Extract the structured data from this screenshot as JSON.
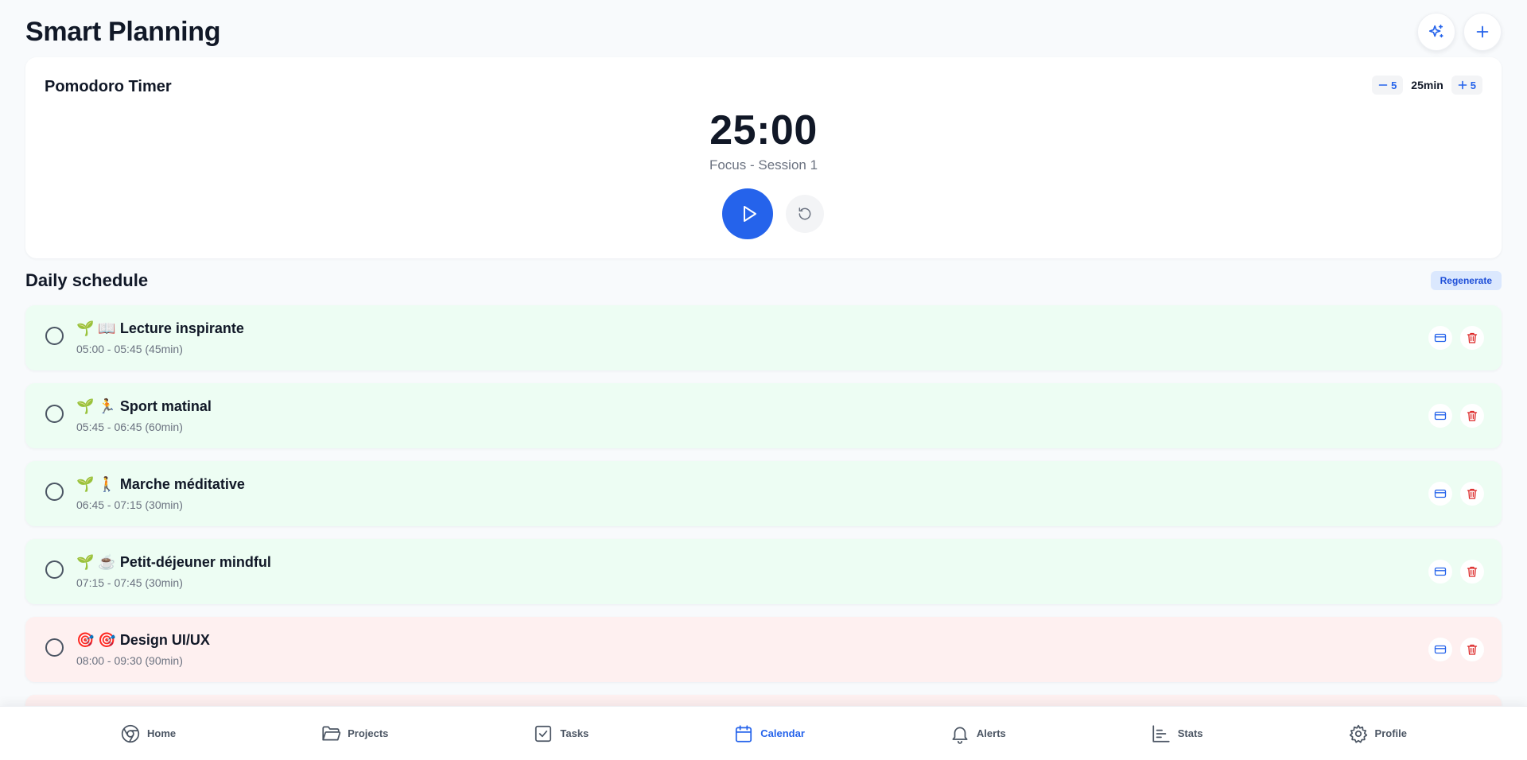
{
  "header": {
    "title": "Smart Planning",
    "ai_icon": "sparkles-icon",
    "add_icon": "plus-icon"
  },
  "pomodoro": {
    "title": "Pomodoro Timer",
    "decrease_label": "5",
    "duration_label": "25min",
    "increase_label": "5",
    "time": "25:00",
    "session": "Focus - Session 1"
  },
  "schedule": {
    "title": "Daily schedule",
    "regenerate_label": "Regenerate",
    "items": [
      {
        "title": "🌱 📖 Lecture inspirante",
        "time": "05:00 - 05:45 (45min)",
        "variant": "green"
      },
      {
        "title": "🌱 🏃 Sport matinal",
        "time": "05:45 - 06:45 (60min)",
        "variant": "green"
      },
      {
        "title": "🌱 🚶 Marche méditative",
        "time": "06:45 - 07:15 (30min)",
        "variant": "green"
      },
      {
        "title": "🌱 ☕ Petit-déjeuner mindful",
        "time": "07:15 - 07:45 (30min)",
        "variant": "green"
      },
      {
        "title": "🎯 🎯 Design UI/UX",
        "time": "08:00 - 09:30 (90min)",
        "variant": "red"
      },
      {
        "title": "",
        "time": "",
        "variant": "red"
      }
    ]
  },
  "nav": {
    "items": [
      {
        "label": "Home",
        "icon": "chrome-icon",
        "active": false
      },
      {
        "label": "Projects",
        "icon": "folder-icon",
        "active": false
      },
      {
        "label": "Tasks",
        "icon": "checkbox-icon",
        "active": false
      },
      {
        "label": "Calendar",
        "icon": "calendar-icon",
        "active": true
      },
      {
        "label": "Alerts",
        "icon": "bell-icon",
        "active": false
      },
      {
        "label": "Stats",
        "icon": "bar-chart-icon",
        "active": false
      },
      {
        "label": "Profile",
        "icon": "gear-icon",
        "active": false
      }
    ]
  },
  "colors": {
    "accent": "#2563eb",
    "habit_bg": "#edfdf3",
    "focus_bg": "#fef0f0",
    "delete": "#dc2626"
  }
}
